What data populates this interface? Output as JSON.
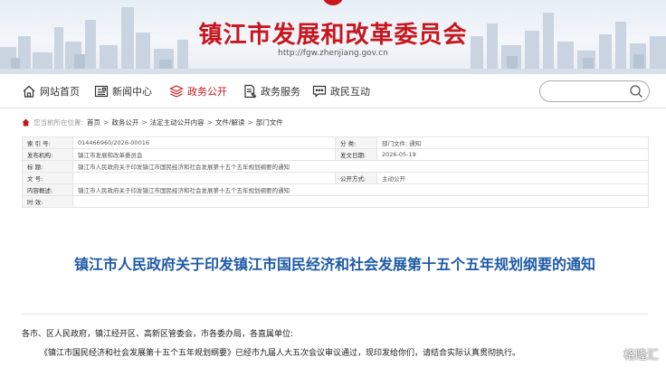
{
  "banner": {
    "title": "镇江市发展和改革委员会",
    "url": "http://fgw.zhenjiang.gov.cn"
  },
  "nav": {
    "items": [
      {
        "label": "网站首页",
        "icon": "house-icon"
      },
      {
        "label": "新闻中心",
        "icon": "newspaper-icon"
      },
      {
        "label": "政务公开",
        "icon": "layers-icon",
        "active": true
      },
      {
        "label": "政务服务",
        "icon": "document-pen-icon"
      },
      {
        "label": "政民互动",
        "icon": "chat-icon"
      }
    ],
    "search_placeholder": ""
  },
  "breadcrumb": {
    "lead": "您当前所在位置:",
    "items": [
      "首页",
      "政务公开",
      "法定主动公开内容",
      "文件/解读",
      "部门文件"
    ]
  },
  "info": {
    "index_no_label": "索 引 号:",
    "index_no": "014466960/2026-00016",
    "category_label": "分 类:",
    "category": "部门文件; 通知",
    "issuer_label": "发布机构:",
    "issuer": "镇江市发展和改革委员会",
    "date_label": "发文日期:",
    "date": "2026-05-19",
    "title_label": "标 题:",
    "title": "镇江市人民政府关于印发镇江市国民经济和社会发展第十五个五年规划纲要的通知",
    "docno_label": "文 号:",
    "docno": "",
    "open_label": "公开方式:",
    "open": "主动公开",
    "summary_label": "内容概述:",
    "summary": "镇江市人民政府关于印发镇江市国民经济和社会发展第十五个五年规划纲要的通知",
    "validity_label": "时 效:",
    "validity": ""
  },
  "document": {
    "title": "镇江市人民政府关于印发镇江市国民经济和社会发展第十五个五年规划纲要的通知",
    "salutation": "各市、区人民政府，镇江经开区、高新区管委会，市各委办局，各直属单位:",
    "paragraph1": "《镇江市国民经济和社会发展第十五个五年规划纲要》已经市九届人大五次会议审议通过，现印发给你们，请结合实际认真贯彻执行。"
  },
  "watermark": "格隆汇",
  "colors": {
    "accent_red": "#c8161e",
    "title_blue": "#1e5aa8"
  }
}
